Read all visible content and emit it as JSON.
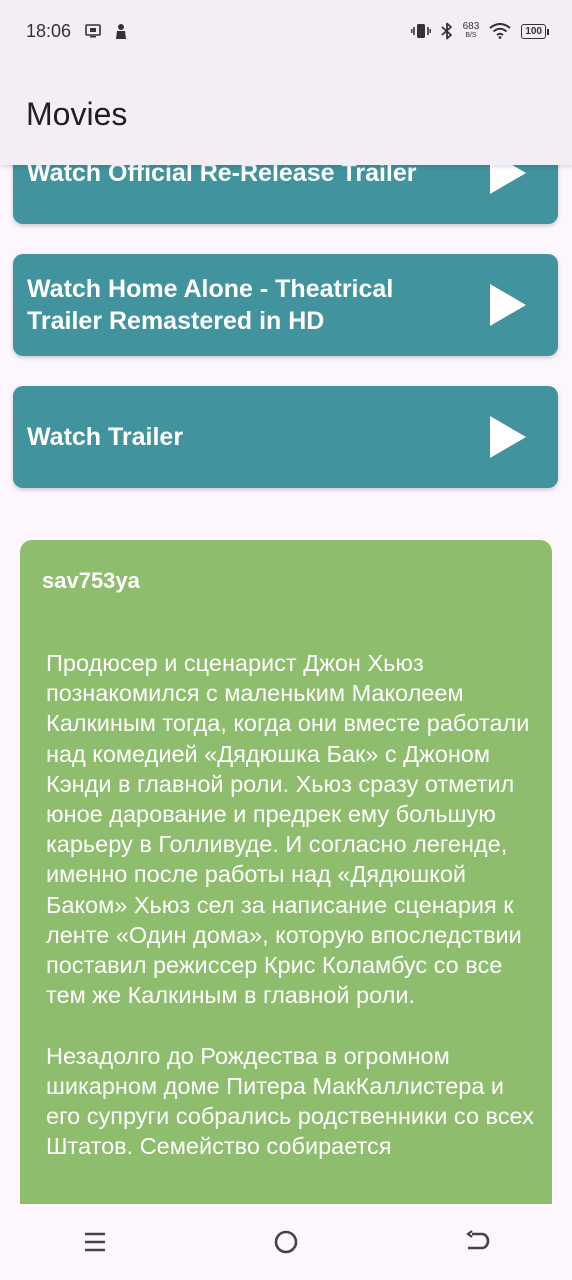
{
  "status_bar": {
    "time": "18:06",
    "net_speed_value": "683",
    "net_speed_unit": "B/S",
    "battery": "100",
    "icons": [
      "screen-record-icon",
      "notification-person-icon",
      "vibrate-icon",
      "bluetooth-icon",
      "wifi-icon",
      "battery-icon"
    ]
  },
  "app_bar": {
    "title": "Movies"
  },
  "trailers": [
    {
      "label": "Watch Official Re-Release Trailer",
      "icon": "play-icon"
    },
    {
      "label": "Watch Home Alone - Theatrical Trailer Remastered in HD",
      "icon": "play-icon"
    },
    {
      "label": "Watch Trailer",
      "icon": "play-icon"
    }
  ],
  "review": {
    "author": "sav753ya",
    "text": "Продюсер и сценарист Джон Хьюз познакомился с маленьким Маколеем Калкиным тогда, когда они вместе работали над комедией «Дядюшка Бак» с Джоном Кэнди в главной роли. Хьюз сразу отметил юное дарование и предрек ему большую карьеру в Голливуде. И согласно легенде, именно после работы над «Дядюшкой Баком» Хьюз сел за написание сценария к ленте «Один дома», которую впоследствии поставил режиссер Крис Коламбус со все тем же Калкиным в главной роли.\n\nНезадолго до Рождества в огромном шикарном доме Питера МакКаллистера и его супруги собрались родственники со всех Штатов. Семейство собирается"
  },
  "nav_bar": {
    "icons": [
      "menu-icon",
      "home-icon",
      "back-icon"
    ]
  },
  "colors": {
    "accent": "#41939d",
    "review_card": "#8fbd6e",
    "background": "#fdf6fd",
    "app_bar": "#f3eef5"
  }
}
